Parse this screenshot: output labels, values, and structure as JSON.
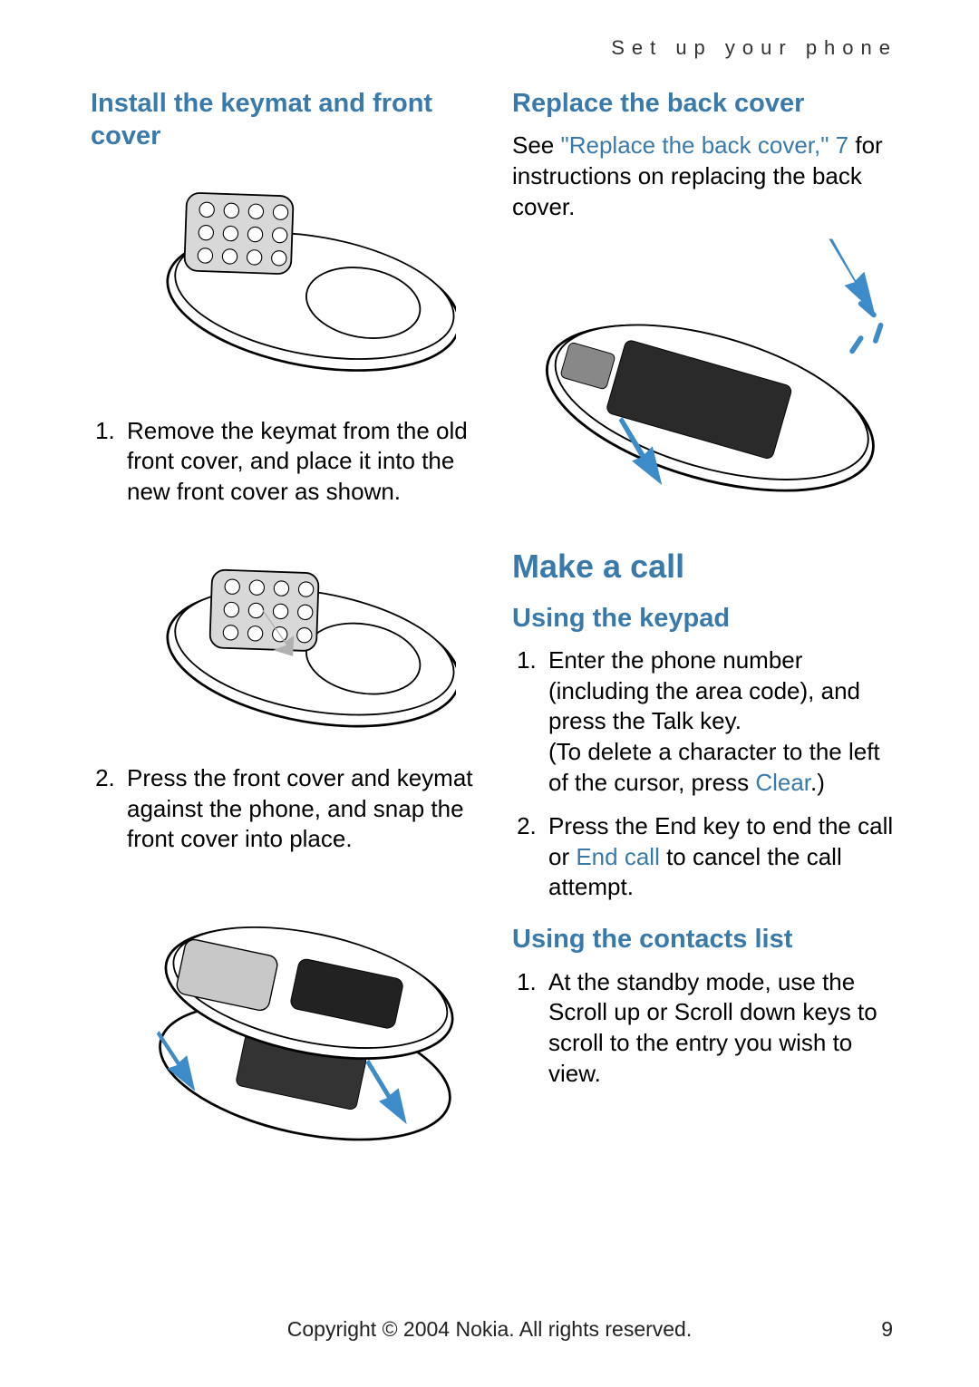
{
  "header": {
    "running": "Set up your phone"
  },
  "left": {
    "h1": "Install the keymat and front cover",
    "step1": "Remove the keymat from the old front cover, and place it into the new front cover as shown.",
    "step2": "Press the front cover and keymat against the phone, and snap the front cover into place."
  },
  "right": {
    "h1": "Replace the back cover",
    "see_pre": "See ",
    "see_link": "\"Replace the back cover,\" 7",
    "see_post": " for instructions on replacing the back cover.",
    "make_call": "Make a call",
    "using_keypad": "Using the keypad",
    "kp1_a": "Enter the phone number (including the area code), and press the ",
    "kp1_talk": "Talk",
    "kp1_b": " key.",
    "kp1_c": "(To delete a character to the left of the cursor, press ",
    "kp1_clear": "Clear",
    "kp1_d": ".)",
    "kp2_a": "Press the ",
    "kp2_end": "End",
    "kp2_b": " key to end the call or ",
    "kp2_endcall": "End call",
    "kp2_c": " to cancel the call attempt.",
    "using_contacts": "Using the contacts list",
    "cl1_a": "At the standby mode, use the ",
    "cl1_su": "Scroll up",
    "cl1_or": " or ",
    "cl1_sd": "Scroll down",
    "cl1_b": " keys to scroll to the entry you wish to view."
  },
  "footer": {
    "copyright": "Copyright © 2004 Nokia. All rights reserved.",
    "page": "9"
  }
}
